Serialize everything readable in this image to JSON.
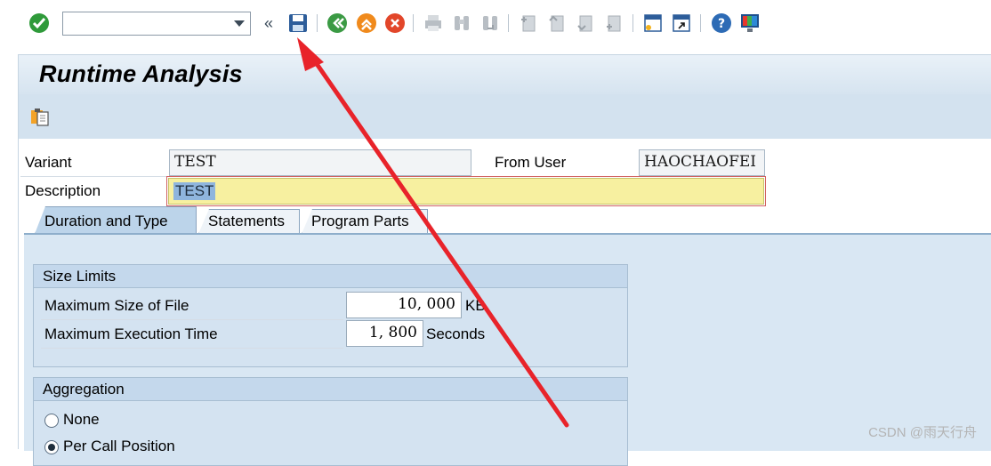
{
  "toolbar": {
    "command_placeholder": "",
    "collapse_glyph": "«",
    "buttons": [
      "enter-icon",
      "save-icon",
      "back-icon",
      "exit-icon",
      "cancel-icon",
      "print-icon",
      "find-icon",
      "find-next-icon",
      "first-page-icon",
      "previous-page-icon",
      "next-page-icon",
      "last-page-icon",
      "create-session-icon",
      "shortcut-icon",
      "help-icon",
      "customize-layout-icon"
    ]
  },
  "screen": {
    "title": "Runtime Analysis"
  },
  "header_fields": {
    "variant_label": "Variant",
    "variant_value": "TEST",
    "from_user_label": "From User",
    "from_user_value": "HAOCHAOFEI",
    "description_label": "Description",
    "description_value": "TEST"
  },
  "tabs": [
    {
      "label": "Duration and Type",
      "active": true
    },
    {
      "label": "Statements",
      "active": false
    },
    {
      "label": "Program Parts",
      "active": false
    }
  ],
  "size_limits": {
    "title": "Size Limits",
    "max_file_label": "Maximum Size of File",
    "max_file_value": "10, 000",
    "max_file_unit": "KB",
    "max_time_label": "Maximum Execution Time",
    "max_time_value": "1, 800",
    "max_time_unit": "Seconds"
  },
  "aggregation": {
    "title": "Aggregation",
    "options": [
      {
        "label": "None",
        "selected": false
      },
      {
        "label": "Per Call Position",
        "selected": true
      }
    ]
  },
  "watermark": "CSDN @雨天行舟",
  "colors": {
    "annotation_arrow": "#e8232a",
    "form_background": "#d9e7f3",
    "description_highlight": "#f7f0a0"
  }
}
